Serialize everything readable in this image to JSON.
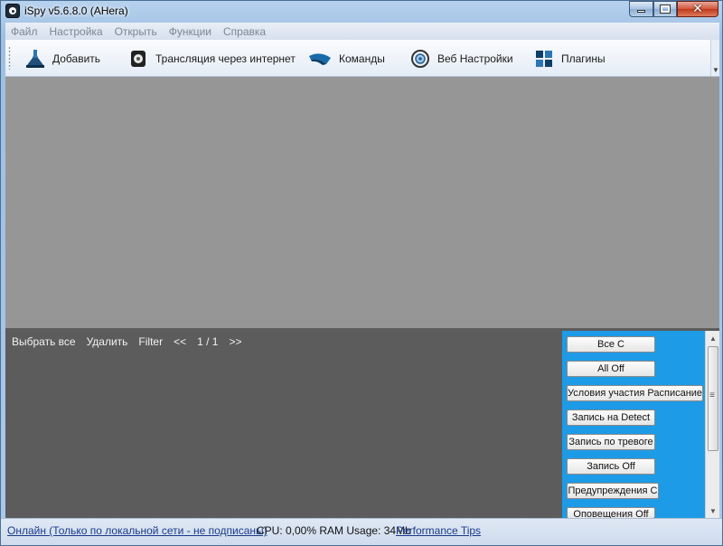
{
  "window": {
    "title": "iSpy v5.6.8.0 (AHera)"
  },
  "menu": {
    "items": [
      "Файл",
      "Настройка",
      "Открыть",
      "Функции",
      "Справка"
    ]
  },
  "toolbar": {
    "items": [
      {
        "label": "Добавить",
        "icon": "add-camera-icon"
      },
      {
        "label": "Трансляция через интернет",
        "icon": "broadcast-icon"
      },
      {
        "label": "Команды",
        "icon": "commands-icon"
      },
      {
        "label": "Веб Настройки",
        "icon": "web-settings-icon"
      },
      {
        "label": "Плагины",
        "icon": "plugins-icon"
      }
    ]
  },
  "list_toolbar": {
    "select_all": "Выбрать все",
    "delete": "Удалить",
    "filter": "Filter",
    "prev": "<<",
    "page": "1 / 1",
    "next": ">>"
  },
  "side_panel": {
    "buttons": [
      "Все С",
      "All Off",
      "Условия участия Расписание",
      "Запись на Detect",
      "Запись по тревоге",
      "Запись Off",
      "Предупреждения С",
      "Оповещения Off"
    ]
  },
  "status": {
    "online": "Онлайн (Только по локальной сети - не подписаны)",
    "stats": "CPU: 0,00% RAM Usage: 34Mb",
    "tips": "Performance Tips"
  },
  "colors": {
    "side_panel": "#1d9be6",
    "bottom_panel": "#5c5c5c",
    "camera_area": "#969696"
  }
}
